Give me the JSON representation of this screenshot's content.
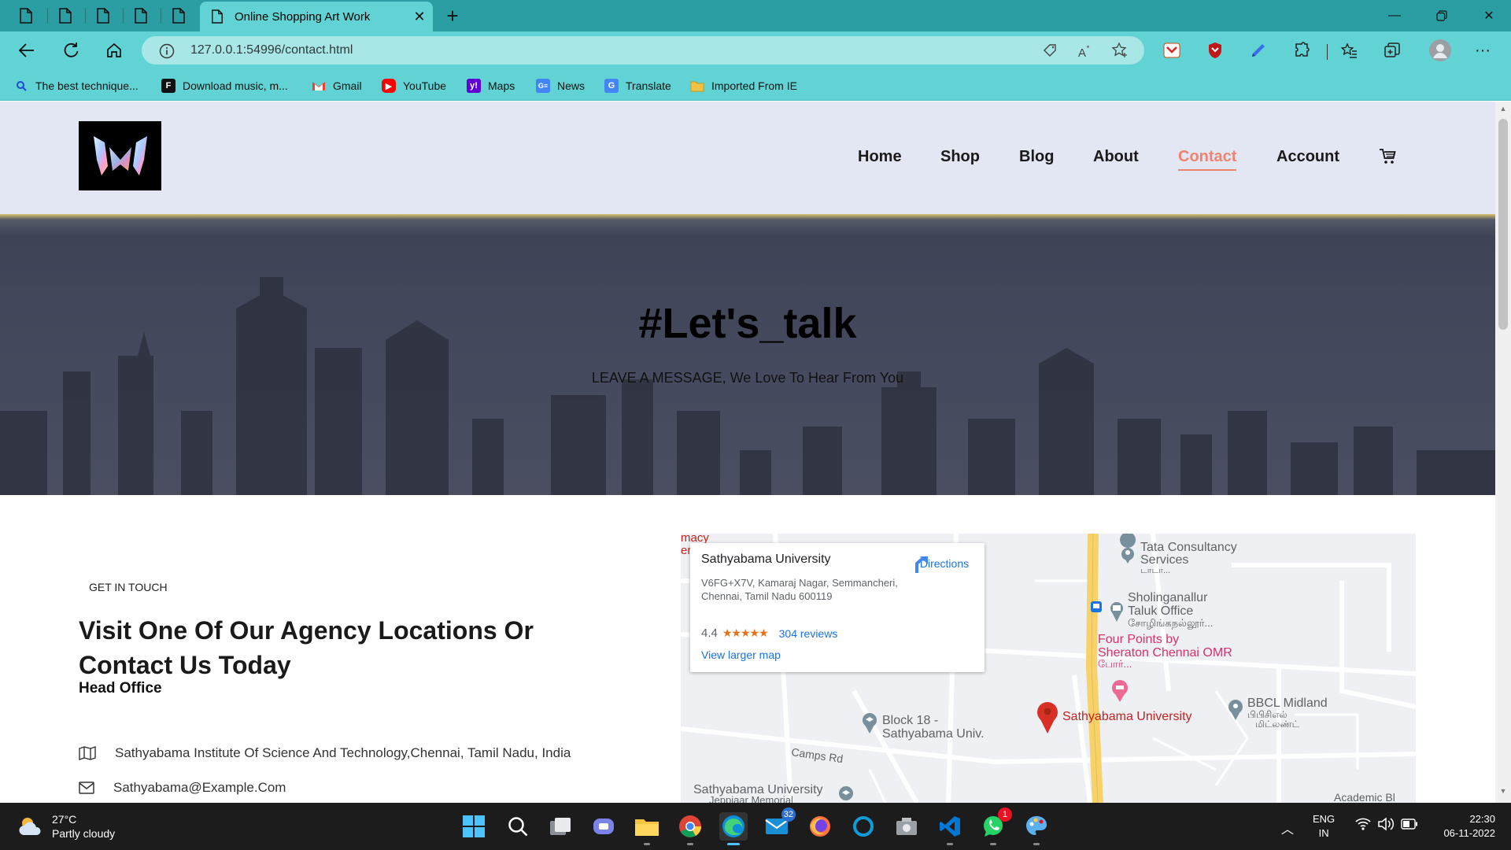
{
  "browser": {
    "tab_title": "Online Shopping Art Work",
    "url": "127.0.0.1:54996/contact.html",
    "bookmarks": [
      {
        "label": "The best technique...",
        "icon": "search-icon"
      },
      {
        "label": "Download music, m...",
        "icon": "f-icon"
      },
      {
        "label": "Gmail",
        "icon": "gmail-icon"
      },
      {
        "label": "YouTube",
        "icon": "youtube-icon"
      },
      {
        "label": "Maps",
        "icon": "yahoo-icon"
      },
      {
        "label": "News",
        "icon": "news-icon"
      },
      {
        "label": "Translate",
        "icon": "translate-icon"
      },
      {
        "label": "Imported From IE",
        "icon": "folder-icon"
      }
    ]
  },
  "site": {
    "nav": [
      "Home",
      "Shop",
      "Blog",
      "About",
      "Contact",
      "Account"
    ],
    "active_nav": "Contact",
    "accent_color": "#f0836f"
  },
  "hero": {
    "title": "#Let's_talk",
    "subtitle": "LEAVE A MESSAGE, We Love To Hear From You"
  },
  "contact": {
    "eyebrow": "GET IN TOUCH",
    "heading": "Visit One Of Our Agency Locations Or Contact Us Today",
    "head_office": "Head Office",
    "address": "Sathyabama Institute Of Science And Technology,Chennai, Tamil Nadu, India",
    "email": "Sathyabama@Example.Com"
  },
  "map": {
    "place": "Sathyabama University",
    "address": "V6FG+X7V, Kamaraj Nagar, Semmancheri, Chennai, Tamil Nadu 600119",
    "rating": "4.4",
    "stars": "★★★★★",
    "reviews": "304 reviews",
    "directions": "Directions",
    "larger_map": "View larger map",
    "labels": {
      "tcs": "Tata Consultancy",
      "tcs2": "Services",
      "tcs3": "டாடா...",
      "sholing": "Sholinganallur",
      "sholing2": "Taluk Office",
      "sholing3": "சோழிங்கநல்லூர்...",
      "fourpoints": "Four Points by",
      "fourpoints2": "Sheraton Chennai OMR",
      "fourpoints3": "போர்...",
      "sathya": "Sathyabama University",
      "block": "Block 18 -",
      "block2": "Sathyabama Univ.",
      "bbcl": "BBCL Midland",
      "bbcl2": "பிபிசிஎல்",
      "bbcl3": "மிட்லண்ட்",
      "camps": "Camps Rd",
      "su_bottom": "Sathyabama University",
      "su_bottom2": "Jeppiaar Memorial",
      "academic": "Academic Bl",
      "pharmacy": "macy",
      "pharmacy2": "er"
    }
  },
  "taskbar": {
    "temp": "27°C",
    "weather": "Partly cloudy",
    "mail_badge": "32",
    "whatsapp_badge": "1",
    "lang1": "ENG",
    "lang2": "IN",
    "time": "22:30",
    "date": "06-11-2022"
  }
}
